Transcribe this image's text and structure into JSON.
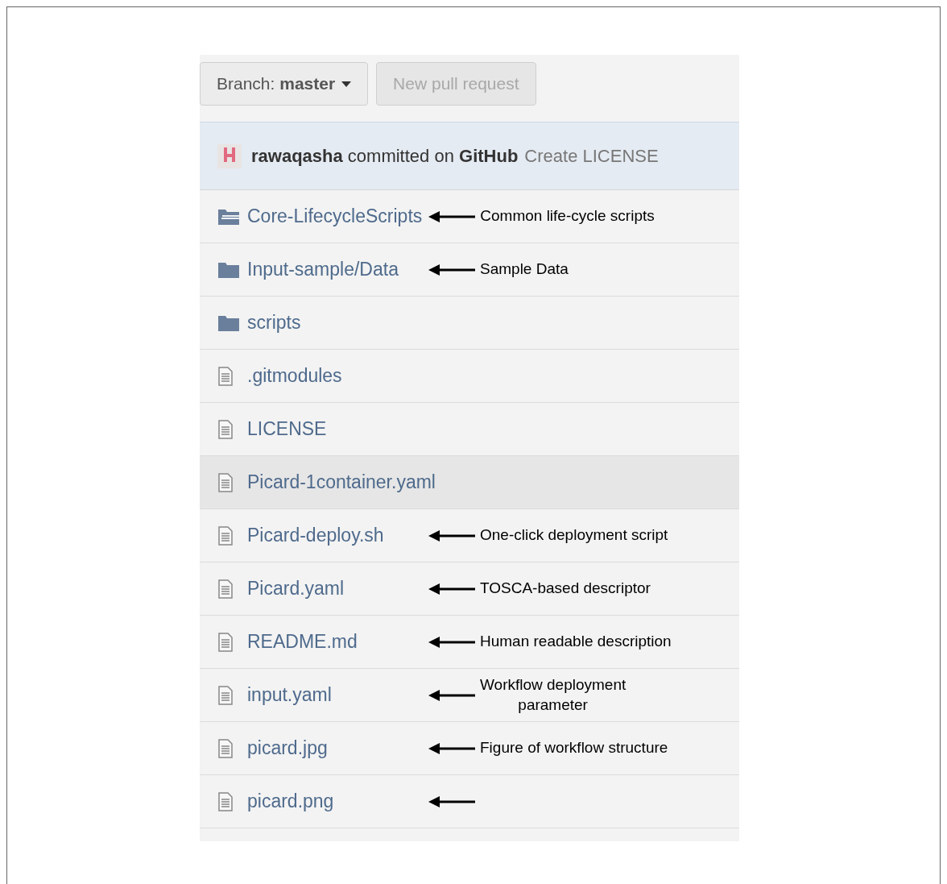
{
  "toolbar": {
    "branch_button": "Branch: **master**",
    "pull_request_button": {
      "label": "New pull request",
      "disabled": true
    }
  },
  "commit_bar": {
    "summary": "**rawaqasha** committed on **GitHub**",
    "message": "Create LICENSE"
  },
  "files": [
    {
      "kind": "folder-stack",
      "name": "Core-LifecycleScripts",
      "highlighted": false,
      "arrow": true,
      "annotation": "Common life-cycle scripts"
    },
    {
      "kind": "folder",
      "name": "Input-sample/Data",
      "highlighted": false,
      "arrow": true,
      "annotation": "Sample Data"
    },
    {
      "kind": "folder",
      "name": "scripts",
      "highlighted": false,
      "arrow": false
    },
    {
      "kind": "file",
      "name": ".gitmodules",
      "highlighted": false,
      "arrow": false
    },
    {
      "kind": "file",
      "name": "LICENSE",
      "highlighted": false,
      "arrow": false
    },
    {
      "kind": "file",
      "name": "Picard-1container.yaml",
      "highlighted": true,
      "arrow": false
    },
    {
      "kind": "file",
      "name": "Picard-deploy.sh",
      "highlighted": false,
      "arrow": true,
      "annotation": "One-click deployment script"
    },
    {
      "kind": "file",
      "name": "Picard.yaml",
      "highlighted": false,
      "arrow": true,
      "annotation": "TOSCA-based descriptor"
    },
    {
      "kind": "file",
      "name": "README.md",
      "highlighted": false,
      "arrow": true,
      "annotation": "Human readable description"
    },
    {
      "kind": "file",
      "name": "input.yaml",
      "highlighted": false,
      "arrow": true,
      "annotation": "Workflow deployment\nparameter"
    },
    {
      "kind": "file",
      "name": "picard.jpg",
      "highlighted": false,
      "arrow": true,
      "annotation": "Figure of workflow structure"
    },
    {
      "kind": "file",
      "name": "picard.png",
      "highlighted": false,
      "arrow": true
    }
  ]
}
